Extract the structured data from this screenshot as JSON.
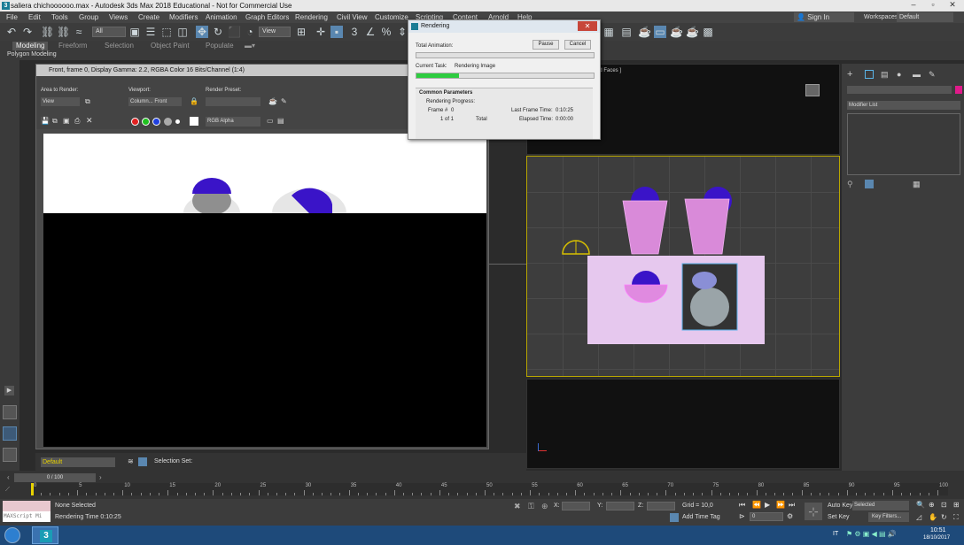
{
  "window": {
    "title": "saliera chichoooooo.max - Autodesk 3ds Max 2018 Educational - Not for Commercial Use",
    "app_icon": "3ds-max-icon"
  },
  "menu": [
    "File",
    "Edit",
    "Tools",
    "Group",
    "Views",
    "Create",
    "Modifiers",
    "Animation",
    "Graph Editors",
    "Rendering",
    "Civil View",
    "Customize",
    "Scripting",
    "Content",
    "Arnold",
    "Help"
  ],
  "account": {
    "sign_in": "Sign In",
    "workspaces_label": "Workspaces:",
    "workspace": "Default"
  },
  "toolbar": {
    "selection_filter": "All",
    "reference_coord": "View"
  },
  "ribbon": {
    "tabs": [
      "Modeling",
      "Freeform",
      "Selection",
      "Object Paint",
      "Populate"
    ],
    "active_tab": "Modeling",
    "sub_label": "Polygon Modeling"
  },
  "render_frame": {
    "title": "Front, frame 0, Display Gamma: 2.2, RGBA Color 16 Bits/Channel (1:4)",
    "area_to_render_label": "Area to Render:",
    "area_to_render_value": "View",
    "viewport_label": "Viewport:",
    "viewport_value": "Column... Front",
    "render_preset_label": "Render Preset:",
    "render_preset_value": "",
    "channel_value": "RGB Alpha"
  },
  "rendering_dialog": {
    "title": "Rendering",
    "pause_label": "Pause",
    "cancel_label": "Cancel",
    "total_animation_label": "Total Animation:",
    "total_animation_progress": 0.0,
    "current_task_label": "Current Task:",
    "current_task_value": "Rendering Image",
    "current_task_progress": 0.24,
    "common_params_label": "Common Parameters",
    "rendering_progress_label": "Rendering Progress:",
    "frame_label": "Frame #",
    "frame_value": "0",
    "of_label": "1 of 1",
    "total_label": "Total",
    "last_frame_time_label": "Last Frame Time:",
    "last_frame_time_value": "0:10:25",
    "elapsed_label": "Elapsed Time:",
    "elapsed_value": "0:00:00"
  },
  "viewport_label_right": "nd Faces ]",
  "command_panel": {
    "modifier_list": "Modifier List"
  },
  "bottom_left": {
    "selection_preset": "Default",
    "selection_set_label": "Selection Set:"
  },
  "timeline": {
    "frame_counter": "0 / 100",
    "tick_labels": [
      "0",
      "5",
      "10",
      "15",
      "20",
      "25",
      "30",
      "35",
      "40",
      "45",
      "50",
      "55",
      "60",
      "65",
      "70",
      "75",
      "80",
      "85",
      "90",
      "95",
      "100"
    ]
  },
  "status": {
    "maxscript_label": "MAXScript Mi",
    "selection_status": "None Selected",
    "render_time": "Rendering Time  0:10:25",
    "x_label": "X:",
    "y_label": "Y:",
    "z_label": "Z:",
    "grid": "Grid = 10,0",
    "add_time_tag": "Add Time Tag",
    "auto_key": "Auto Key",
    "selected": "Selected",
    "set_key": "Set Key",
    "key_filters": "Key Filters...",
    "frame_field": "0"
  },
  "taskbar": {
    "lang": "IT",
    "time": "10:51",
    "date": "18/10/2017"
  }
}
